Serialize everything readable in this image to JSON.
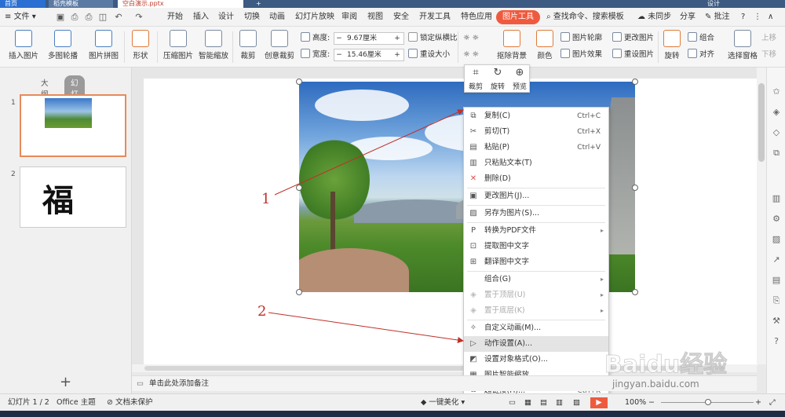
{
  "tabs": {
    "home": "首页",
    "template": "稻壳模板",
    "doc": "空白演示.pptx",
    "user": "设计"
  },
  "menu": {
    "file": "文件",
    "items": [
      "开始",
      "插入",
      "设计",
      "切换",
      "动画",
      "幻灯片放映",
      "审阅",
      "视图",
      "安全",
      "开发工具",
      "特色应用"
    ],
    "active": "图片工具",
    "search": "查找命令、搜索模板",
    "sync": "未同步",
    "share": "分享",
    "comment": "批注",
    "help": "?"
  },
  "ribbon": {
    "insert_picture": "插入图片",
    "multi_frame": "多图轮播",
    "collage": "图片拼图",
    "shape": "形状",
    "compress": "压缩图片",
    "smart_scale": "智能缩放",
    "crop": "裁剪",
    "creative_crop": "创意裁剪",
    "height_label": "高度:",
    "height_value": "9.67厘米",
    "width_label": "宽度:",
    "width_value": "15.46厘米",
    "lock_ratio": "锁定纵横比",
    "reset_size": "重设大小",
    "remove_bg": "抠除背景",
    "color": "颜色",
    "outline": "图片轮廓",
    "effects": "图片效果",
    "change_pic": "更改图片",
    "reset_pic": "重设图片",
    "rotate": "旋转",
    "group": "组合",
    "align": "对齐",
    "select_pane": "选择窗格",
    "up": "上移",
    "down": "下移"
  },
  "left_pane": {
    "outline_tab": "大纲",
    "slides_tab": "幻灯片",
    "slide1_num": "1",
    "slide2_num": "2",
    "slide2_text": "福",
    "add": "+"
  },
  "mini_toolbar": {
    "crop": "裁剪",
    "rotate": "旋转",
    "preview": "预览"
  },
  "context_menu": {
    "items": [
      {
        "label": "复制(C)",
        "key": "Ctrl+C",
        "icon": "copy-icon"
      },
      {
        "label": "剪切(T)",
        "key": "Ctrl+X",
        "icon": "cut-icon"
      },
      {
        "label": "粘贴(P)",
        "key": "Ctrl+V",
        "icon": "paste-icon"
      },
      {
        "label": "只粘贴文本(T)",
        "key": "",
        "icon": "paste-text-icon"
      },
      {
        "label": "删除(D)",
        "key": "",
        "icon": "delete-icon"
      },
      {
        "label": "更改图片(J)...",
        "key": "",
        "icon": "change-picture-icon"
      },
      {
        "label": "另存为图片(S)...",
        "key": "",
        "icon": "save-picture-icon"
      },
      {
        "label": "转换为PDF文件",
        "key": "",
        "icon": "pdf-icon"
      },
      {
        "label": "提取图中文字",
        "key": "",
        "icon": "extract-text-icon"
      },
      {
        "label": "翻译图中文字",
        "key": "",
        "icon": "translate-icon"
      },
      {
        "label": "组合(G)",
        "key": "",
        "icon": ""
      },
      {
        "label": "置于顶层(U)",
        "key": "",
        "icon": "bring-front-icon"
      },
      {
        "label": "置于底层(K)",
        "key": "",
        "icon": "send-back-icon"
      },
      {
        "label": "自定义动画(M)...",
        "key": "",
        "icon": "animation-icon"
      },
      {
        "label": "动作设置(A)...",
        "key": "",
        "icon": "action-icon"
      },
      {
        "label": "设置对象格式(O)...",
        "key": "",
        "icon": "format-icon"
      },
      {
        "label": "图片智能缩放",
        "key": "",
        "icon": "smart-scale-icon"
      },
      {
        "label": "超链接(H)...",
        "key": "Ctrl+K",
        "icon": "hyperlink-icon"
      }
    ]
  },
  "annotations": {
    "one": "1",
    "two": "2"
  },
  "notes": {
    "placeholder": "单击此处添加备注"
  },
  "status": {
    "slide_info": "幻灯片 1 / 2",
    "theme": "Office 主题",
    "protect": "文档未保护",
    "beautify": "一键美化",
    "zoom": "100%"
  },
  "watermark": {
    "brand": "Baidu经验",
    "url": "jingyan.baidu.com"
  },
  "colors": {
    "accent": "#ef5a3e",
    "arrow": "#c0302a"
  }
}
